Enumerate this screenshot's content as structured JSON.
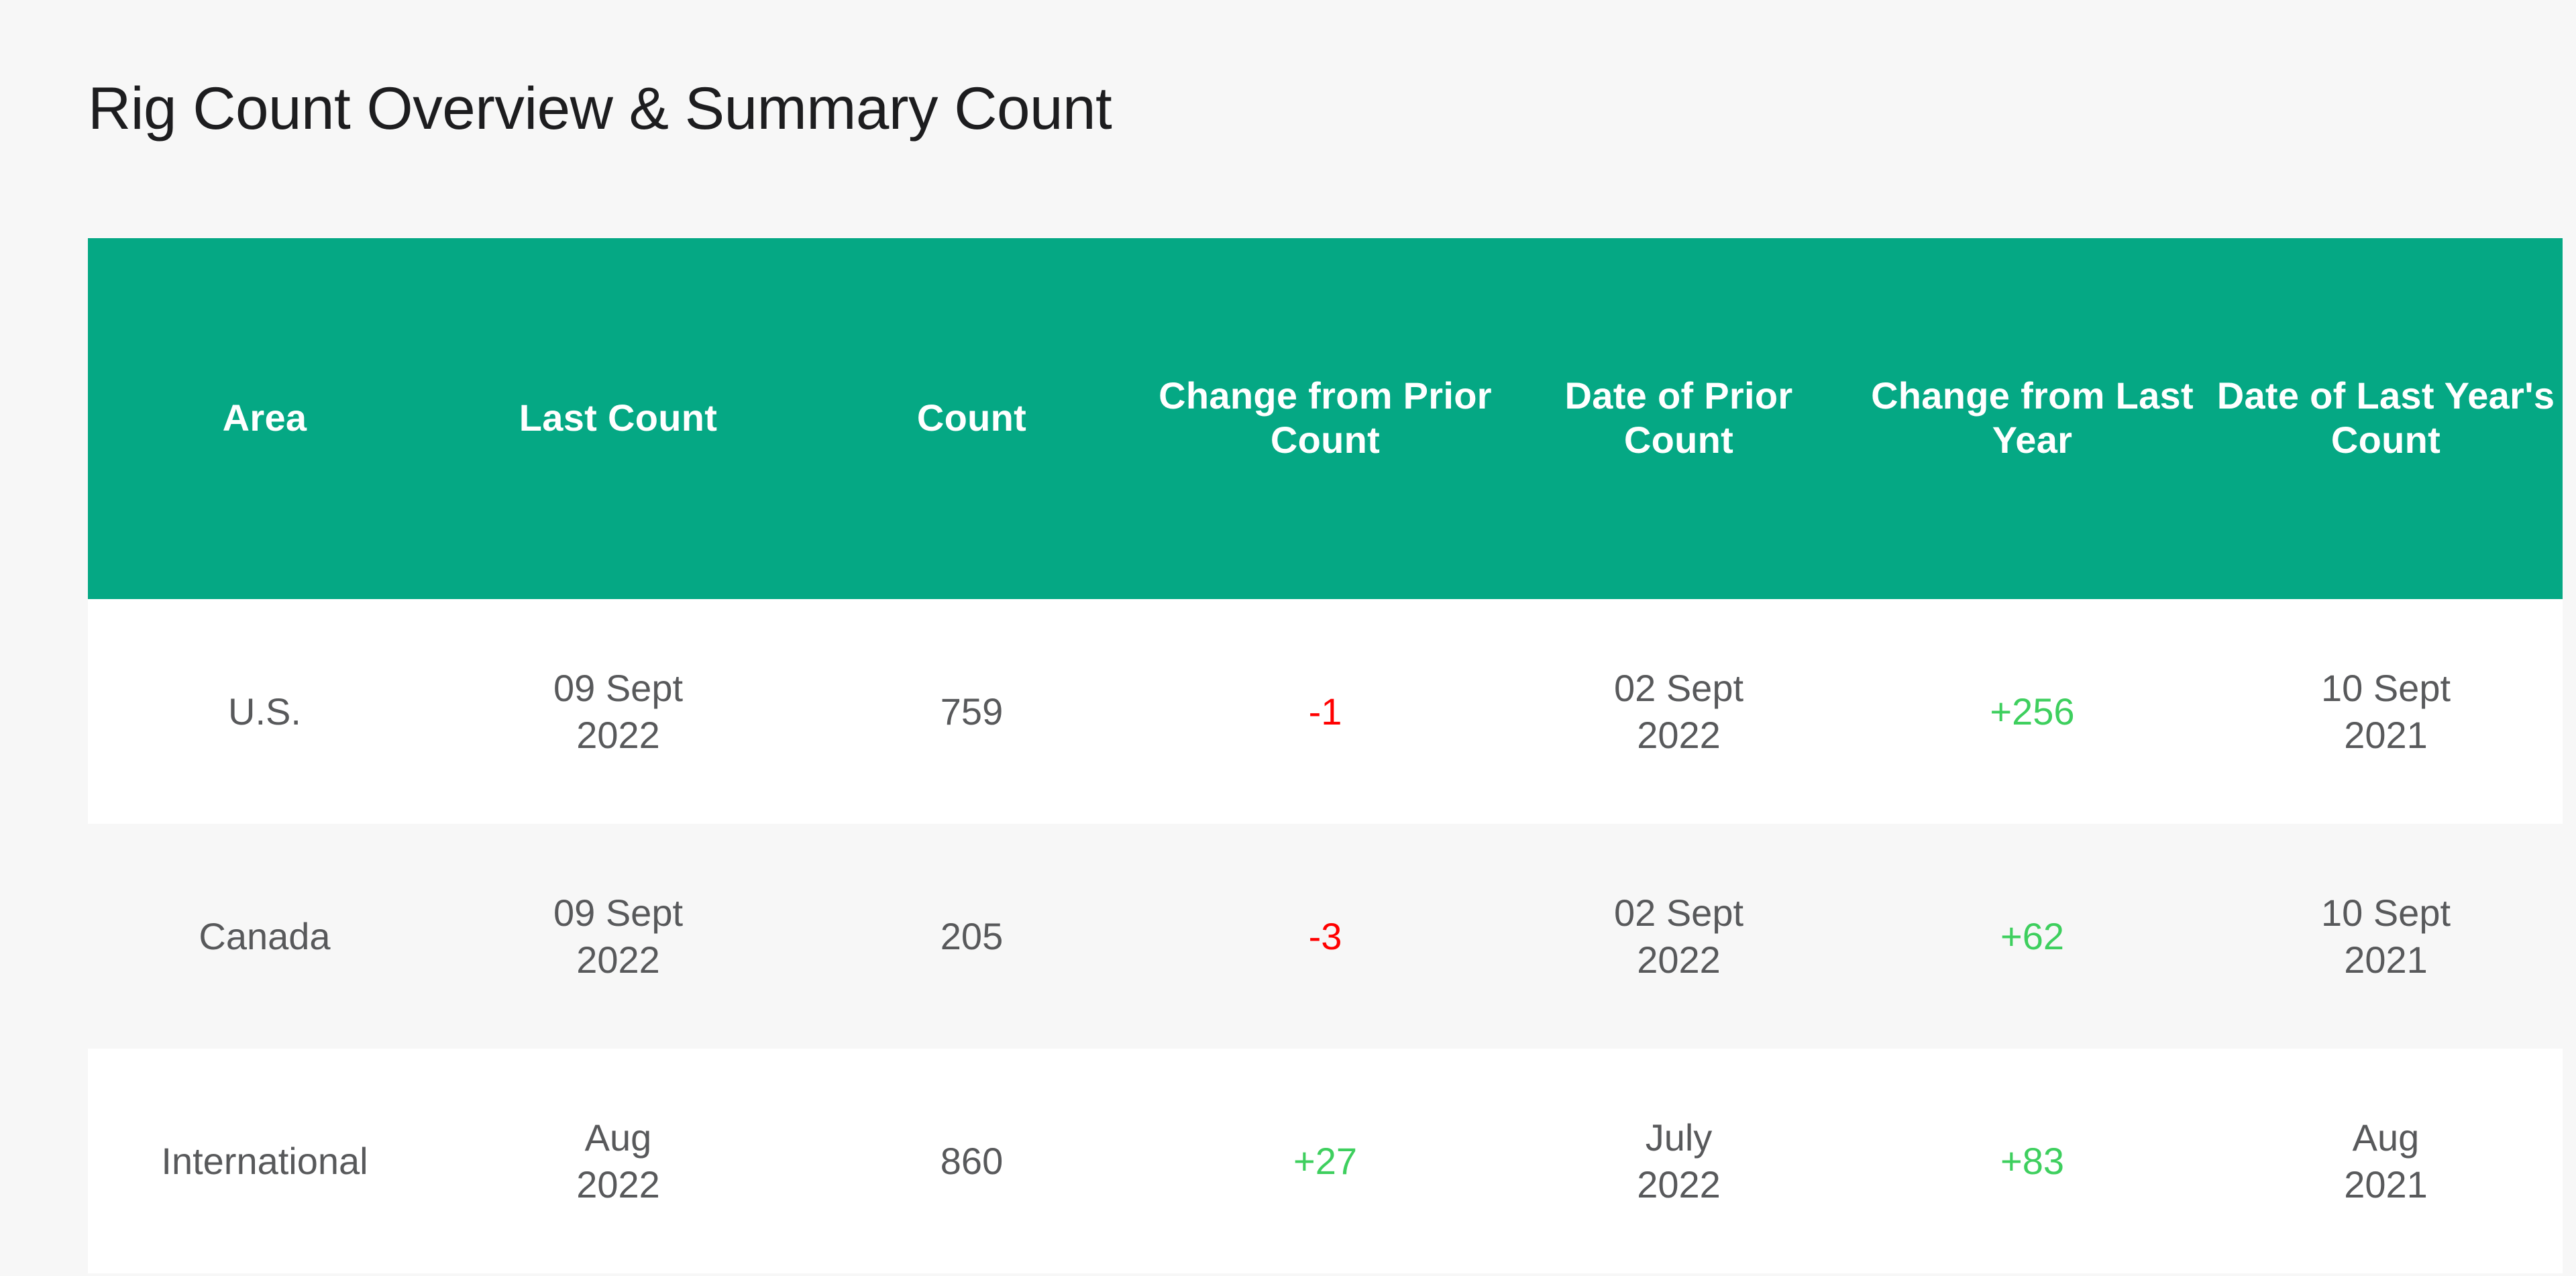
{
  "header": {
    "title": "Rig Count Overview & Summary Count"
  },
  "theme": {
    "page_background": "#f7f7f7",
    "table_header_background": "#05a884",
    "table_header_text": "#ffffff",
    "row_alt_background": "#f7f7f7",
    "row_background": "#ffffff",
    "cell_text": "#58595b",
    "negative_color": "#ff0000",
    "positive_color": "#3ecf5e"
  },
  "table": {
    "columns": [
      {
        "key": "area",
        "label": "Area"
      },
      {
        "key": "last_count",
        "label": "Last Count"
      },
      {
        "key": "count",
        "label": "Count"
      },
      {
        "key": "change_prior",
        "label": "Change from Prior Count"
      },
      {
        "key": "date_prior",
        "label": "Date of Prior Count"
      },
      {
        "key": "change_year",
        "label": "Change from Last Year"
      },
      {
        "key": "date_last_year",
        "label": "Date of Last Year's Count"
      }
    ],
    "rows": [
      {
        "area": "U.S.",
        "last_count_line1": "09 Sept",
        "last_count_line2": "2022",
        "count": "759",
        "change_prior": "-1",
        "change_prior_sign": "negative",
        "date_prior_line1": "02 Sept",
        "date_prior_line2": "2022",
        "change_year": "+256",
        "change_year_sign": "positive",
        "date_last_year_line1": "10 Sept",
        "date_last_year_line2": "2021"
      },
      {
        "area": "Canada",
        "last_count_line1": "09 Sept",
        "last_count_line2": "2022",
        "count": "205",
        "change_prior": "-3",
        "change_prior_sign": "negative",
        "date_prior_line1": "02 Sept",
        "date_prior_line2": "2022",
        "change_year": "+62",
        "change_year_sign": "positive",
        "date_last_year_line1": "10 Sept",
        "date_last_year_line2": "2021"
      },
      {
        "area": "International",
        "last_count_line1": "Aug",
        "last_count_line2": "2022",
        "count": "860",
        "change_prior": "+27",
        "change_prior_sign": "positive",
        "date_prior_line1": "July",
        "date_prior_line2": "2022",
        "change_year": "+83",
        "change_year_sign": "positive",
        "date_last_year_line1": "Aug",
        "date_last_year_line2": "2021"
      }
    ]
  }
}
